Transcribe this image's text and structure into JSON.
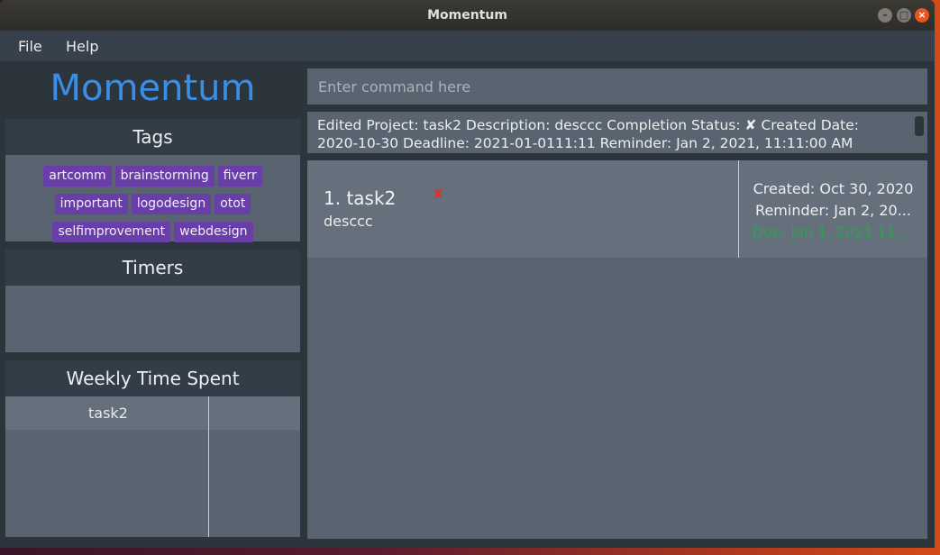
{
  "window": {
    "title": "Momentum",
    "controls": {
      "minimize": "–",
      "maximize": "□",
      "close": "×"
    }
  },
  "menu": {
    "file": "File",
    "help": "Help"
  },
  "brand": "Momentum",
  "tags_panel": {
    "title": "Tags",
    "tags": [
      "artcomm",
      "brainstorming",
      "fiverr",
      "important",
      "logodesign",
      "otot",
      "selfimprovement",
      "webdesign"
    ]
  },
  "timers_panel": {
    "title": "Timers"
  },
  "weekly_panel": {
    "title": "Weekly Time Spent",
    "rows": [
      {
        "name": "task2",
        "time": ""
      }
    ]
  },
  "command": {
    "placeholder": "Enter command here",
    "value": ""
  },
  "result": {
    "text": "Edited Project: task2 Description: desccc Completion Status: ✘ Created Date: 2020-10-30 Deadline: 2021-01-0111:11 Reminder: Jan 2, 2021, 11:11:00 AM"
  },
  "projects": [
    {
      "index_name": "1. task2",
      "completion_mark": "✘",
      "description": "desccc",
      "created": "Created: Oct 30, 2020",
      "reminder": "Reminder: Jan 2, 20...",
      "due": "Due: Jan 1, 2021 11:..."
    }
  ],
  "colors": {
    "brand": "#3a8ee6",
    "tag_bg": "#6a3ea8",
    "due": "#2ea050",
    "incomplete_mark": "#e03030"
  }
}
